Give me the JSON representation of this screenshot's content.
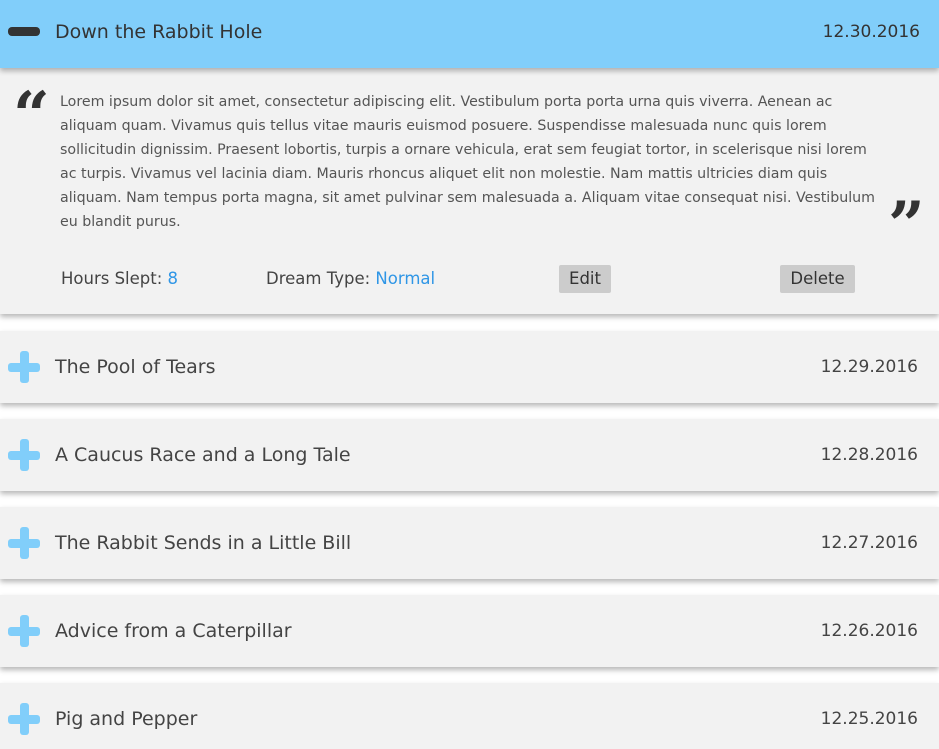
{
  "expanded_entry": {
    "title": "Down the Rabbit Hole",
    "date": "12.30.2016",
    "text": "Lorem ipsum dolor sit amet, consectetur adipiscing elit. Vestibulum porta porta urna quis viverra. Aenean ac aliquam quam. Vivamus quis tellus vitae mauris euismod posuere. Suspendisse malesuada nunc quis lorem sollicitudin dignissim. Praesent lobortis, turpis a ornare vehicula, erat sem feugiat tortor, in scelerisque nisi lorem ac turpis. Vivamus vel lacinia diam. Mauris rhoncus aliquet elit non molestie. Nam mattis ultricies diam quis aliquam. Nam tempus porta magna, sit amet pulvinar sem malesuada a. Aliquam vitae consequat nisi. Vestibulum eu blandit purus.",
    "hours_label": "Hours Slept: ",
    "hours_value": "8",
    "type_label": "Dream Type: ",
    "type_value": "Normal",
    "edit_label": "Edit",
    "delete_label": "Delete",
    "open_quote": "“",
    "close_quote": "”",
    "toggle_icon": "minus-icon"
  },
  "entries": [
    {
      "title": "The Pool of Tears",
      "date": "12.29.2016",
      "icon": "plus-icon"
    },
    {
      "title": "A Caucus Race and a Long Tale",
      "date": "12.28.2016",
      "icon": "plus-icon"
    },
    {
      "title": "The Rabbit Sends in a Little Bill",
      "date": "12.27.2016",
      "icon": "plus-icon"
    },
    {
      "title": "Advice from a Caterpillar",
      "date": "12.26.2016",
      "icon": "plus-icon"
    },
    {
      "title": "Pig and Pepper",
      "date": "12.25.2016",
      "icon": "plus-icon"
    }
  ],
  "colors": {
    "header_active": "#81cefa",
    "panel": "#f2f2f2",
    "accent_text": "#2f96e6",
    "button": "#cccccc",
    "plus_icon": "#81cefa"
  }
}
